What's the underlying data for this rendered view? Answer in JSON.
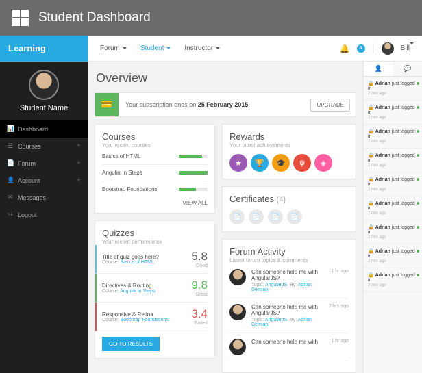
{
  "topbar": {
    "title": "Student Dashboard"
  },
  "brand": "Learning",
  "topnav": [
    {
      "label": "Forum",
      "active": false
    },
    {
      "label": "Student",
      "active": true
    },
    {
      "label": "Instructor",
      "active": false
    }
  ],
  "header_user": {
    "name": "Bill",
    "notif_count": "4"
  },
  "profile": {
    "name": "Student Name"
  },
  "sidenav": [
    {
      "icon": "chart",
      "label": "Dashboard",
      "plus": false,
      "active": true
    },
    {
      "icon": "list",
      "label": "Courses",
      "plus": true
    },
    {
      "icon": "doc",
      "label": "Forum",
      "plus": true
    },
    {
      "icon": "user",
      "label": "Account",
      "plus": true
    },
    {
      "icon": "msg",
      "label": "Messages",
      "plus": false
    },
    {
      "icon": "out",
      "label": "Logout",
      "plus": false
    }
  ],
  "page": {
    "title": "Overview"
  },
  "subscription": {
    "prefix": "Your subscription ends on ",
    "date": "25 February 2015",
    "upgrade": "UPGRADE"
  },
  "courses": {
    "title": "Courses",
    "sub": "Your recent courses",
    "items": [
      {
        "name": "Basics of HTML",
        "pct": 80
      },
      {
        "name": "Angular in Steps",
        "pct": 100
      },
      {
        "name": "Bootstrap Foundations",
        "pct": 60
      }
    ],
    "view_all": "VIEW ALL"
  },
  "quizzes": {
    "title": "Quizzes",
    "sub": "Your recent performance",
    "items": [
      {
        "title": "Title of quiz goes here?",
        "course_prefix": "Course: ",
        "course": "Basics of HTML",
        "score": "5.8",
        "label": "Good",
        "cls": "good"
      },
      {
        "title": "Directives & Routing",
        "course_prefix": "Course: ",
        "course": "Angular in Steps",
        "score": "9.8",
        "label": "Great",
        "cls": "great"
      },
      {
        "title": "Responsive & Retina",
        "course_prefix": "Course: ",
        "course": "Bootstrap Foundations",
        "score": "3.4",
        "label": "Failed",
        "cls": "fail"
      }
    ],
    "button": "GO TO RESULTS"
  },
  "rewards": {
    "title": "Rewards",
    "sub": "Your latest achievements"
  },
  "certificates": {
    "title": "Certificates",
    "count": "(4)"
  },
  "forum": {
    "title": "Forum Activity",
    "sub": "Latest forum topics & comments",
    "items": [
      {
        "title": "Can someone help me with AngularJS?",
        "topic_prefix": "Topic: ",
        "topic": "AngularJS",
        "by_prefix": "By: ",
        "by": "Adrian Demian",
        "time": "1 hr ago"
      },
      {
        "title": "Can someone help me with AngularJS?",
        "topic_prefix": "Topic: ",
        "topic": "AngularJS",
        "by_prefix": "By: ",
        "by": "Adrian Demian",
        "time": "2 hrs ago"
      },
      {
        "title": "Can someone help me with",
        "topic_prefix": "",
        "topic": "",
        "by_prefix": "",
        "by": "",
        "time": "1 hr ago"
      }
    ]
  },
  "feed": [
    {
      "name": "Adrian",
      "action": "just logged in",
      "time": "2 min ago"
    },
    {
      "name": "Adrian",
      "action": "just logged in",
      "time": "2 min ago"
    },
    {
      "name": "Adrian",
      "action": "just logged in",
      "time": "2 min ago"
    },
    {
      "name": "Adrian",
      "action": "just logged in",
      "time": "2 min ago"
    },
    {
      "name": "Adrian",
      "action": "just logged in",
      "time": "2 min ago"
    },
    {
      "name": "Adrian",
      "action": "just logged in",
      "time": "2 min ago"
    },
    {
      "name": "Adrian",
      "action": "just logged in",
      "time": "2 min ago"
    },
    {
      "name": "Adrian",
      "action": "just logged in",
      "time": "2 min ago"
    },
    {
      "name": "Adrian",
      "action": "just logged in",
      "time": "2 min ago"
    }
  ]
}
